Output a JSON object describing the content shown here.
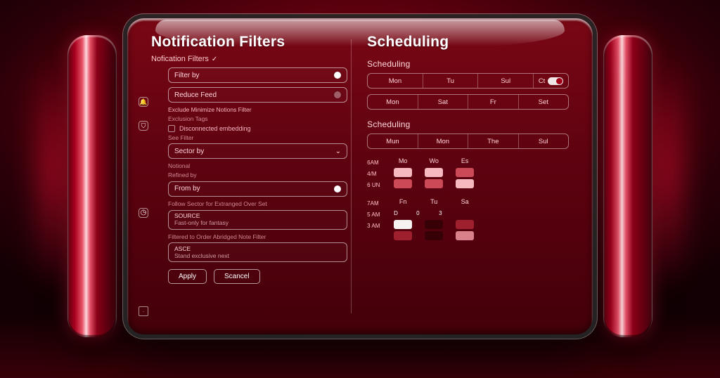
{
  "left": {
    "title": "Notification Filters",
    "subtitle": "Nofication Filters",
    "toggle1": {
      "label": "Filter by"
    },
    "toggle2": {
      "label": "Reduce Feed"
    },
    "note1": "Exclude Minimize Notions Filter",
    "note2": "Exclusion Tags",
    "checkbox": "Disconnected embedding",
    "note3": "See Filter",
    "select1": {
      "label": "Sector by"
    },
    "note4": "Notional",
    "note5": "Refined by",
    "toggle3": {
      "label": "From by"
    },
    "note6": "Follow Sector for Extranged Over Set",
    "select2": {
      "line1": "SOURCE",
      "line2": "Fast-only for fantasy"
    },
    "note7": "Filtered to Order Abridged Note Filter",
    "select3": {
      "line1": "ASCE",
      "line2": "Stand exclusive next"
    },
    "buttons": {
      "apply": "Apply",
      "cancel": "Scancel"
    }
  },
  "right": {
    "title": "Scheduling",
    "section1": "Scheduling",
    "bar1": [
      "Mon",
      "Tu",
      "Sul",
      "Ct"
    ],
    "bar2": [
      "Mon",
      "Sat",
      "Fr",
      "Set"
    ],
    "section2": "Scheduling",
    "bar3": [
      "Mun",
      "Mon",
      "The",
      "Sul"
    ],
    "timesA": [
      "6AM",
      "4/M",
      "6 UN"
    ],
    "hdrA": [
      "Mo",
      "Wo",
      "Es"
    ],
    "timesB": [
      "7AM",
      "5 AM",
      "3 AM"
    ],
    "hdrB": [
      "Fn",
      "Tu",
      "Sa"
    ]
  }
}
